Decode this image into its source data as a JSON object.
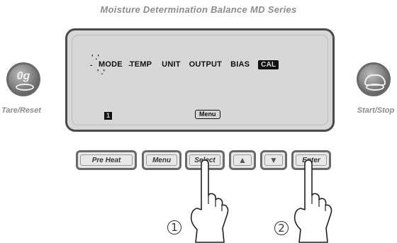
{
  "device": {
    "title": "Moisture Determination Balance  MD Series"
  },
  "display": {
    "menu_items": [
      "MODE",
      "TEMP",
      "UNIT",
      "OUTPUT",
      "BIAS",
      "CAL"
    ],
    "selected_item": "MODE",
    "highlighted_item": "CAL",
    "page_number": "1",
    "menu_indicator": "Menu"
  },
  "side_buttons": {
    "tare": {
      "glyph": "0g",
      "label": "Tare/Reset",
      "icon": "tare-pan-icon"
    },
    "start": {
      "label": "Start/Stop",
      "icon": "start-stop-icon"
    }
  },
  "keys": {
    "preheat": "Pre Heat",
    "menu": "Menu",
    "select": "Select",
    "up": "▲",
    "down": "▼",
    "enter": "Enter"
  },
  "steps": {
    "one": "1",
    "two": "2"
  },
  "colors": {
    "lcd_background": "#d7d7d7",
    "frame": "#4a4a4a",
    "label_gray": "#8c8c8c"
  }
}
